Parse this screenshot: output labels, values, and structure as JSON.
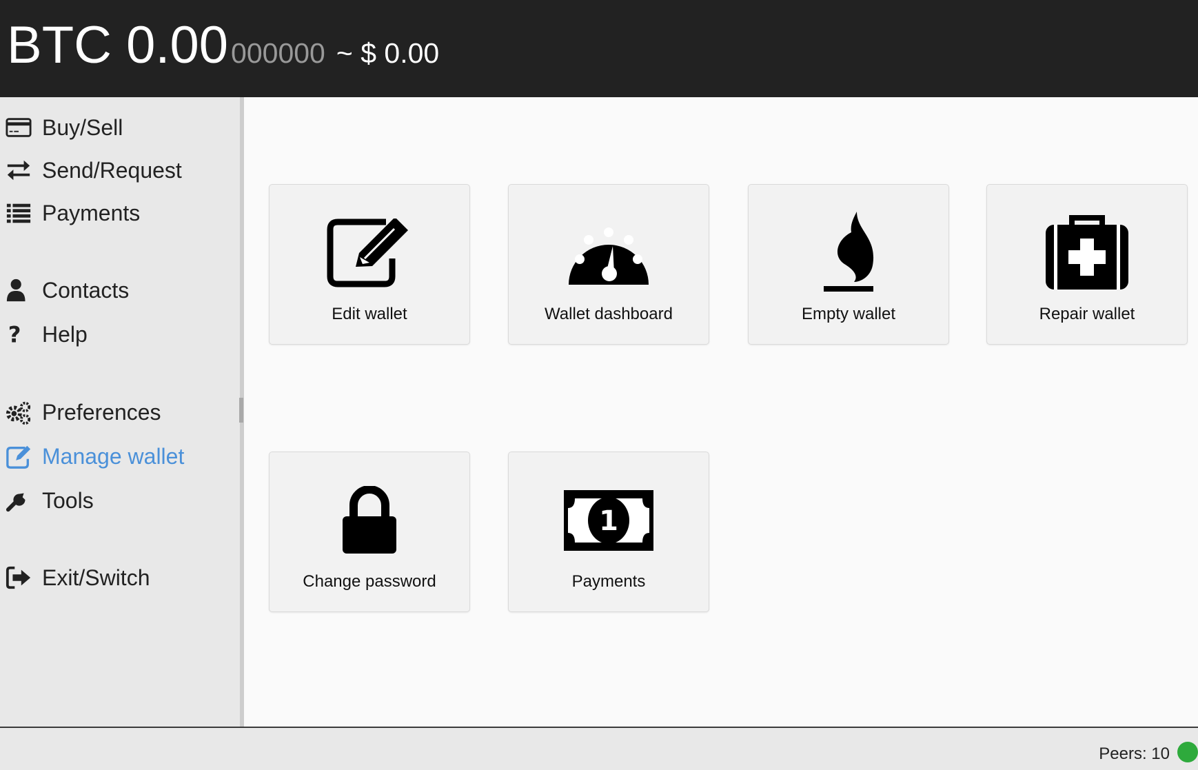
{
  "header": {
    "balance_main": "BTC 0.00",
    "balance_small_digits": "000000",
    "balance_fiat": "~ $ 0.00"
  },
  "sidebar": {
    "items": [
      {
        "label": "Buy/Sell",
        "icon": "credit-card-icon"
      },
      {
        "label": "Send/Request",
        "icon": "exchange-arrows-icon"
      },
      {
        "label": "Payments",
        "icon": "list-icon"
      },
      {
        "label": "Contacts",
        "icon": "user-icon"
      },
      {
        "label": "Help",
        "icon": "question-icon"
      },
      {
        "label": "Preferences",
        "icon": "gears-icon"
      },
      {
        "label": "Manage wallet",
        "icon": "edit-icon",
        "active": true
      },
      {
        "label": "Tools",
        "icon": "wrench-icon"
      },
      {
        "label": "Exit/Switch",
        "icon": "sign-out-icon"
      }
    ],
    "active_color": "#4a90d9"
  },
  "tiles": [
    {
      "label": "Edit wallet",
      "icon": "edit-icon"
    },
    {
      "label": "Wallet dashboard",
      "icon": "dashboard-icon"
    },
    {
      "label": "Empty wallet",
      "icon": "fire-icon"
    },
    {
      "label": "Repair wallet",
      "icon": "medkit-icon"
    },
    {
      "label": "Change password",
      "icon": "lock-icon"
    },
    {
      "label": "Payments",
      "icon": "money-bill-icon"
    }
  ],
  "status": {
    "peers": "Peers: 10",
    "peer_status_color": "#2eaa3c"
  }
}
